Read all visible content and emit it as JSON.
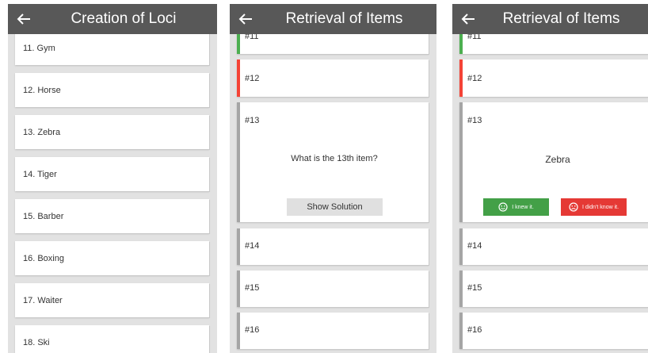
{
  "screens": [
    {
      "title": "Creation of Loci",
      "loci": [
        "11. Gym",
        "12. Horse",
        "13. Zebra",
        "14. Tiger",
        "15. Barber",
        "16. Boxing",
        "17. Waiter",
        "18. Ski"
      ]
    },
    {
      "title": "Retrieval of Items",
      "items": [
        {
          "num": "#11",
          "status": "green"
        },
        {
          "num": "#12",
          "status": "red"
        },
        {
          "num": "#13",
          "status": "grey",
          "question": "What is the 13th item?",
          "button": "Show Solution"
        },
        {
          "num": "#14",
          "status": "grey"
        },
        {
          "num": "#15",
          "status": "grey"
        },
        {
          "num": "#16",
          "status": "grey"
        }
      ]
    },
    {
      "title": "Retrieval of Items",
      "items": [
        {
          "num": "#11",
          "status": "green"
        },
        {
          "num": "#12",
          "status": "red"
        },
        {
          "num": "#13",
          "status": "grey",
          "answer": "Zebra",
          "knew_label": "I knew it.",
          "didnt_label": "I didn't know it."
        },
        {
          "num": "#14",
          "status": "grey"
        },
        {
          "num": "#15",
          "status": "grey"
        },
        {
          "num": "#16",
          "status": "grey"
        }
      ]
    }
  ],
  "icons": {
    "back": "arrow-left-icon",
    "smile": "smile-icon",
    "sad": "sad-icon"
  },
  "colors": {
    "appbar": "#585858",
    "background": "#e2e2e2",
    "green": "#4caf50",
    "red": "#f44336",
    "grey_bar": "#a5a5a5",
    "button_grey": "#e0e0e0"
  }
}
